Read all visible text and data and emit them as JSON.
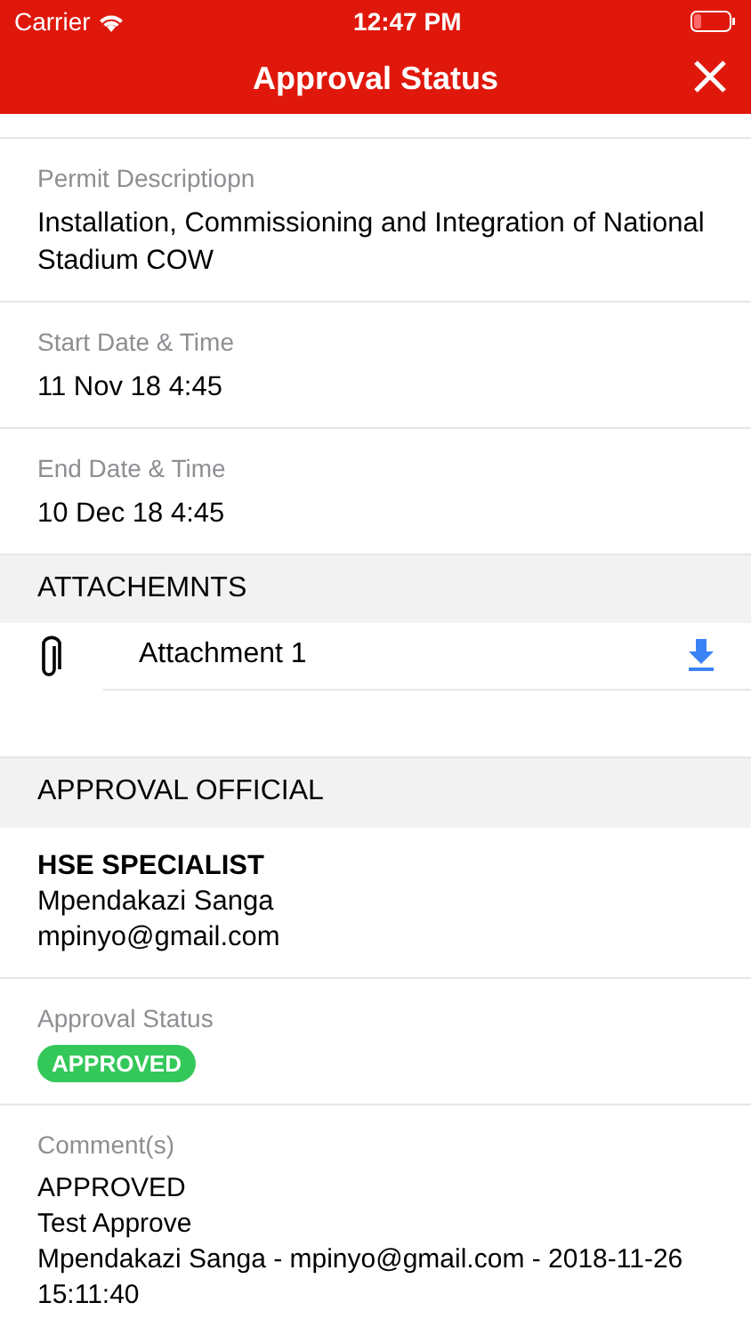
{
  "status_bar": {
    "carrier": "Carrier",
    "time": "12:47 PM",
    "battery_low": true
  },
  "nav": {
    "title": "Approval Status"
  },
  "fields": [
    {
      "label": "Permit Descriptiopn",
      "value": "Installation, Commissioning and Integration of National Stadium COW"
    },
    {
      "label": "Start Date & Time",
      "value": "11 Nov 18 4:45"
    },
    {
      "label": "End Date & Time",
      "value": "10 Dec 18 4:45"
    }
  ],
  "attachments": {
    "header": "ATTACHEMNTS",
    "items": [
      {
        "name": "Attachment 1"
      }
    ]
  },
  "approval": {
    "header": "APPROVAL OFFICIAL",
    "role": "HSE SPECIALIST",
    "name": "Mpendakazi Sanga",
    "email": "mpinyo@gmail.com",
    "status_label": "Approval Status",
    "status": {
      "text": "APPROVED",
      "kind": "approved"
    },
    "comments_label": "Comment(s)",
    "comments": [
      "APPROVED",
      "Test Approve",
      "Mpendakazi Sanga - mpinyo@gmail.com - 2018-11-26 15:11:40"
    ]
  }
}
